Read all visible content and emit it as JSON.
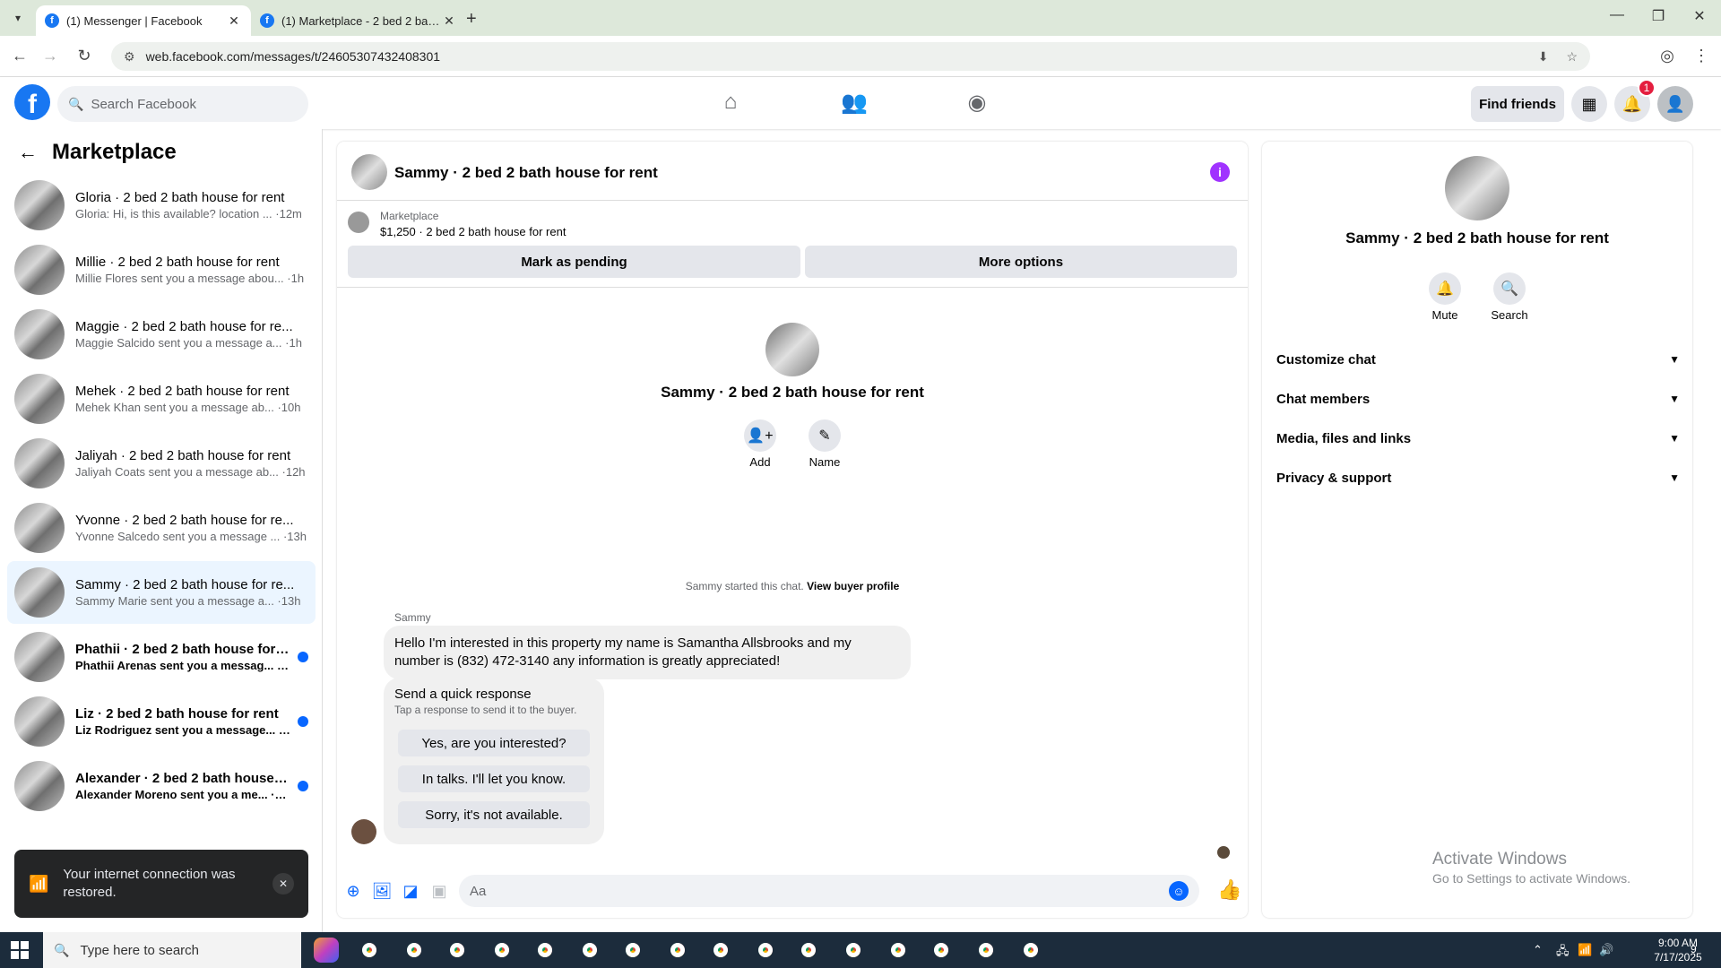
{
  "browser": {
    "tabs": [
      {
        "title": "(1) Messenger | Facebook",
        "active": true
      },
      {
        "title": "(1) Marketplace - 2 bed 2 bath h",
        "active": false
      }
    ],
    "url": "web.facebook.com/messages/t/24605307432408301"
  },
  "fb": {
    "search_placeholder": "Search Facebook",
    "find_friends": "Find friends",
    "notification_count": "1"
  },
  "sidebar": {
    "title": "Marketplace",
    "conversations": [
      {
        "name": "Gloria · 2 bed 2 bath house for rent",
        "preview": "Gloria: Hi, is this available? location ... ·12m",
        "unread": false
      },
      {
        "name": "Millie · 2 bed 2 bath house for rent",
        "preview": "Millie Flores sent you a message abou... ·1h",
        "unread": false
      },
      {
        "name": "Maggie · 2 bed 2 bath house for re...",
        "preview": "Maggie Salcido sent you a message a... ·1h",
        "unread": false
      },
      {
        "name": "Mehek · 2 bed 2 bath house for rent",
        "preview": "Mehek Khan sent you a message ab... ·10h",
        "unread": false
      },
      {
        "name": "Jaliyah · 2 bed 2 bath house for rent",
        "preview": "Jaliyah Coats sent you a message ab... ·12h",
        "unread": false
      },
      {
        "name": "Yvonne · 2 bed 2 bath house for re...",
        "preview": "Yvonne Salcedo sent you a message ... ·13h",
        "unread": false
      },
      {
        "name": "Sammy · 2 bed 2 bath house for re...",
        "preview": "Sammy Marie sent you a message a... ·13h",
        "unread": false,
        "selected": true
      },
      {
        "name": "Phathii · 2 bed 2 bath house for r...",
        "preview": "Phathii Arenas sent you a messag... ·18h",
        "unread": true
      },
      {
        "name": "Liz · 2 bed 2 bath house for rent",
        "preview": "Liz Rodriguez sent you a message... ·18h",
        "unread": true
      },
      {
        "name": "Alexander · 2 bed 2 bath house f...",
        "preview": "Alexander Moreno sent you a me... ·21h",
        "unread": true
      }
    ]
  },
  "toast": {
    "message": "Your internet connection was restored."
  },
  "chat": {
    "title": "Sammy · 2 bed 2 bath house for rent",
    "marketplace_label": "Marketplace",
    "listing": "$1,250 · 2 bed 2 bath house for rent",
    "mark_pending": "Mark as pending",
    "more_options": "More options",
    "center_name": "Sammy · 2 bed 2 bath house for rent",
    "add_label": "Add",
    "name_label": "Name",
    "started_text": "Sammy started this chat.",
    "view_buyer": "View buyer profile",
    "sender": "Sammy",
    "message": "Hello I'm interested in this property my name is Samantha Allsbrooks and my number is (832) 472-3140 any information is greatly appreciated!",
    "quick_title": "Send a quick response",
    "quick_sub": "Tap a response to send it to the buyer.",
    "quick_responses": [
      "Yes, are you interested?",
      "In talks. I'll let you know.",
      "Sorry, it's not available."
    ],
    "composer_placeholder": "Aa"
  },
  "info": {
    "name": "Sammy · 2 bed 2 bath house for rent",
    "mute": "Mute",
    "search": "Search",
    "sections": [
      "Customize chat",
      "Chat members",
      "Media, files and links",
      "Privacy & support"
    ]
  },
  "watermark": {
    "title": "Activate Windows",
    "sub": "Go to Settings to activate Windows."
  },
  "taskbar": {
    "search_placeholder": "Type here to search",
    "time": "9:00 AM",
    "date": "7/17/2025",
    "notif_count": "9"
  }
}
